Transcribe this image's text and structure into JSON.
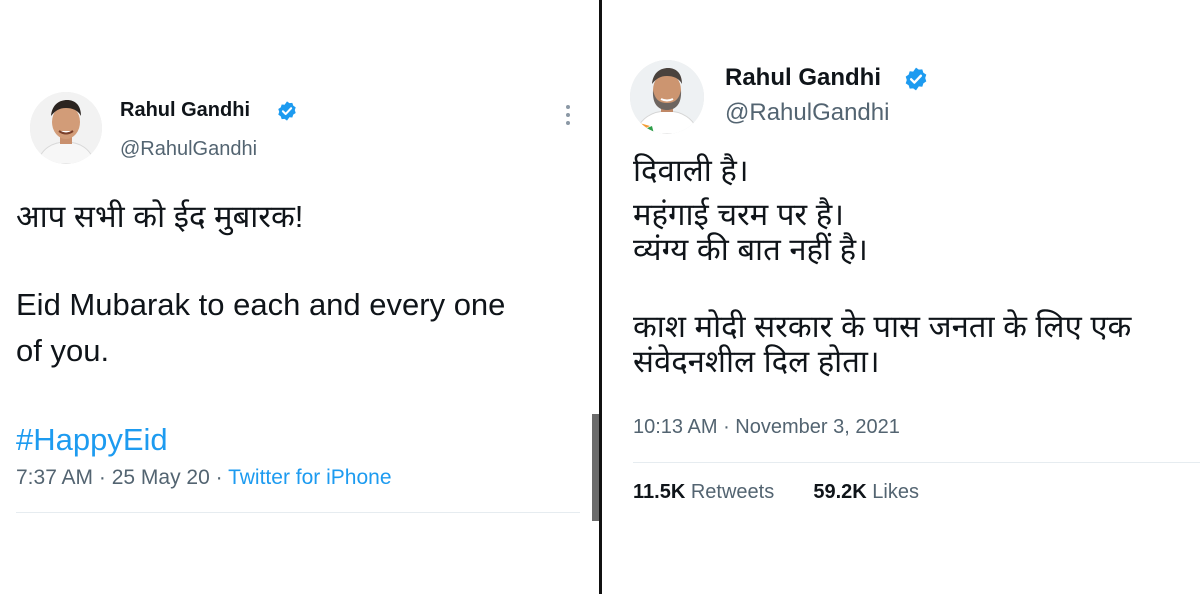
{
  "left_tweet": {
    "author": {
      "name": "Rahul Gandhi",
      "handle": "@RahulGandhi",
      "verified_icon": "verified-badge-icon"
    },
    "more_icon": "more-vertical-icon",
    "text": {
      "hindi": "आप सभी को ईद मुबारक!",
      "english_line1": "Eid Mubarak to each and every one",
      "english_line2": "of you.",
      "hashtag": "#HappyEid"
    },
    "meta": {
      "time": "7:37 AM",
      "separator": " · ",
      "date": "25 May 20",
      "source": "Twitter for iPhone"
    }
  },
  "right_tweet": {
    "author": {
      "name": "Rahul Gandhi",
      "handle": "@RahulGandhi",
      "verified_icon": "verified-badge-icon"
    },
    "text": {
      "line1": "दिवाली है।",
      "line2": "महंगाई चरम पर है।",
      "line3": "व्यंग्य की बात नहीं है।",
      "line4": "काश मोदी सरकार के पास जनता के लिए एक",
      "line5": "संवेदनशील दिल होता।"
    },
    "meta": {
      "time": "10:13 AM",
      "separator": " · ",
      "date": "November 3, 2021"
    },
    "stats": {
      "retweets_count": "11.5K",
      "retweets_label": "Retweets",
      "likes_count": "59.2K",
      "likes_label": "Likes"
    }
  },
  "colors": {
    "link_blue": "#1d9bf0",
    "secondary_text": "#536471",
    "primary_text": "#0f1419"
  }
}
